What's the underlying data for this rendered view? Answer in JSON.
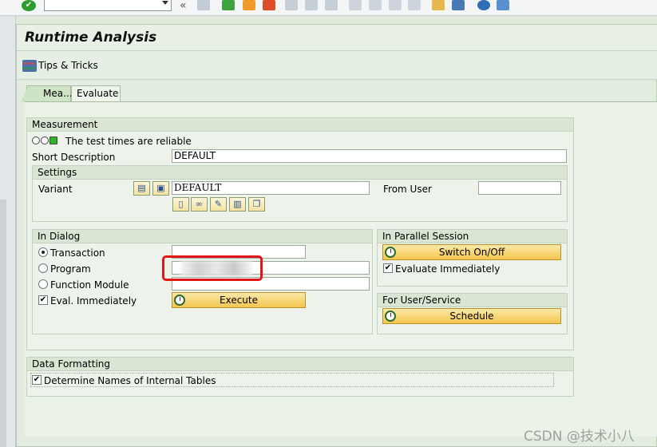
{
  "window": {
    "title": "Runtime Analysis"
  },
  "toolbar": {
    "command_field": ""
  },
  "app_toolbar": {
    "tips_label": "Tips & Tricks"
  },
  "tabs": [
    {
      "label": "Mea...",
      "active": true
    },
    {
      "label": "Evaluate",
      "active": false
    }
  ],
  "measurement": {
    "group_title": "Measurement",
    "status_text": "The test times are reliable",
    "short_description_label": "Short Description",
    "short_description_value": "DEFAULT",
    "settings": {
      "group_title": "Settings",
      "variant_label": "Variant",
      "variant_value": "DEFAULT",
      "from_user_label": "From User",
      "from_user_value": ""
    }
  },
  "in_dialog": {
    "group_title": "In Dialog",
    "options": [
      {
        "label": "Transaction",
        "selected": true,
        "value": ""
      },
      {
        "label": "Program",
        "selected": false,
        "value": ""
      },
      {
        "label": "Function Module",
        "selected": false,
        "value": ""
      }
    ],
    "eval_immediately_label": "Eval. Immediately",
    "eval_immediately_checked": true,
    "execute_label": "Execute"
  },
  "parallel_session": {
    "group_title": "In Parallel Session",
    "switch_label": "Switch On/Off",
    "evaluate_immediately_label": "Evaluate Immediately",
    "evaluate_immediately_checked": true
  },
  "user_service": {
    "group_title": "For User/Service",
    "schedule_label": "Schedule"
  },
  "data_formatting": {
    "group_title": "Data Formatting",
    "determine_names_label": "Determine Names of Internal Tables",
    "determine_names_checked": true
  },
  "watermark": "CSDN @技术小八",
  "colors": {
    "button_yellow": "#f3c64e",
    "panel_green": "#e3eddf",
    "highlight_red": "#e21616"
  }
}
